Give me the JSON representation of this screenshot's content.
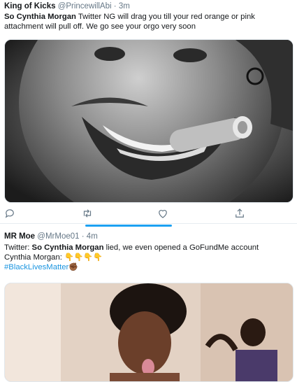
{
  "tweets": [
    {
      "name": "King of Kicks",
      "handle": "@PrincewillAbi",
      "sep": "·",
      "time": "3m",
      "text_bold": "So Cynthia Morgan",
      "text": " Twitter NG will drag you till your red orange or pink attachment will pull off. We go see your orgo very soon",
      "media_icon": "photo"
    },
    {
      "name": "MR Moe",
      "handle": "@MrMoe01",
      "sep": "·",
      "time": "4m",
      "text_pre": "Twitter: ",
      "text_bold": "So Cynthia Morgan",
      "text_post": " lied, we even opened a GoFundMe account",
      "line2": "Cynthia Morgan: ",
      "emojis": "👇👇👇👇",
      "hashtag": "#BlackLivesMatter",
      "hashtag_emoji": "✊🏾",
      "media_icon": "photo"
    }
  ],
  "actions": {
    "reply_icon": "reply-icon",
    "retweet_icon": "retweet-icon",
    "like_icon": "heart-icon",
    "share_icon": "share-icon"
  },
  "colors": {
    "accent": "#1da1f2",
    "secondary_text": "#657786",
    "icon": "#657786",
    "divider": "#e6ecf0"
  }
}
